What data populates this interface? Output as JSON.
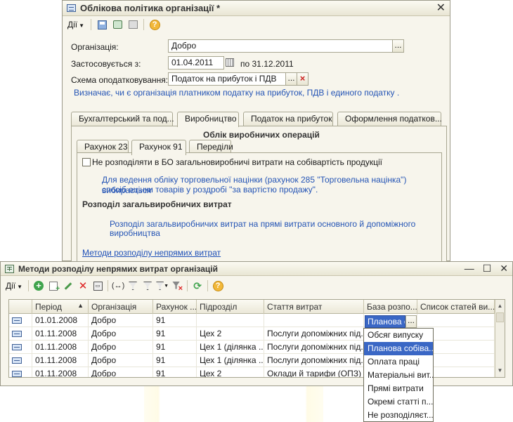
{
  "main_window": {
    "title": "Облікова політика організації *",
    "toolbar": {
      "actions_label": "Дії",
      "help_label": "?"
    },
    "fields": {
      "organization_label": "Організація:",
      "organization_value": "Добро",
      "applies_from_label": "Застосовується з:",
      "applies_from_value": "01.04.2011",
      "applies_to_text": "по 31.12.2011",
      "tax_scheme_label": "Схема оподатковування:",
      "tax_scheme_value": "Податок на прибуток і ПДВ",
      "tax_scheme_hint": "Визначає, чи є організація платником податку на прибуток, ПДВ і единого податку ."
    },
    "tabs": [
      "Бухгалтерський та под...",
      "Виробництво",
      "Податок на прибуток",
      "Оформлення податков..."
    ],
    "production": {
      "section_title": "Облік виробничих операцій",
      "subtabs": [
        "Рахунок 23",
        "Рахунок 91",
        "Переділи"
      ],
      "checkbox_label": "Не розподіляти в БО загальновиробничі витрати на собівартість продукції",
      "markup_hint_line1": "Для ведення обліку торговельної націнки (рахунок 285 \"Торговельна націнка\") вибирається",
      "markup_hint_line2": "спосіб оцінки товарів у роздробі \"за вартістю продажу\".",
      "distribution_title": "Розподіл загальвиробничих витрат",
      "distribution_hint_line1": "Розподіл загальвиробничих витрат на прямі витрати основного й допоміжного",
      "distribution_hint_line2": "виробництва",
      "methods_link": "Методи розподілу непрямих витрат"
    }
  },
  "methods_window": {
    "title": "Методи розподілу непрямих витрат організацій",
    "toolbar": {
      "actions_label": "Дії",
      "help_label": "?"
    },
    "columns": [
      "Період",
      "Організація",
      "Рахунок ...",
      "Підрозділ",
      "Стаття витрат",
      "База розпо...",
      "Список статей ви..."
    ],
    "rows": [
      {
        "period": "01.01.2008",
        "org": "Добро",
        "account": "91",
        "dept": "",
        "cost_item": "",
        "base": "Планова с",
        "list": ""
      },
      {
        "period": "01.11.2008",
        "org": "Добро",
        "account": "91",
        "dept": "Цех 2",
        "cost_item": "Послуги допоміжних під...",
        "base": "",
        "list": ""
      },
      {
        "period": "01.11.2008",
        "org": "Добро",
        "account": "91",
        "dept": "Цех 1 (ділянка ...",
        "cost_item": "Послуги допоміжних під...",
        "base": "",
        "list": ""
      },
      {
        "period": "01.11.2008",
        "org": "Добро",
        "account": "91",
        "dept": "Цех 1 (ділянка ...",
        "cost_item": "Послуги допоміжних під...",
        "base": "",
        "list": ""
      },
      {
        "period": "01.11.2008",
        "org": "Добро",
        "account": "91",
        "dept": "Цех 2",
        "cost_item": "Оклади й тарифи (ОПЗ)",
        "base": "",
        "list": ""
      }
    ],
    "dropdown_options": [
      "Обсяг випуску",
      "Планова собіва...",
      "Оплата праці",
      "Матеріальні вит...",
      "Прямі витрати",
      "Окремі статті п...",
      "Не розподіляєт..."
    ],
    "dropdown_selected_index": 1
  }
}
